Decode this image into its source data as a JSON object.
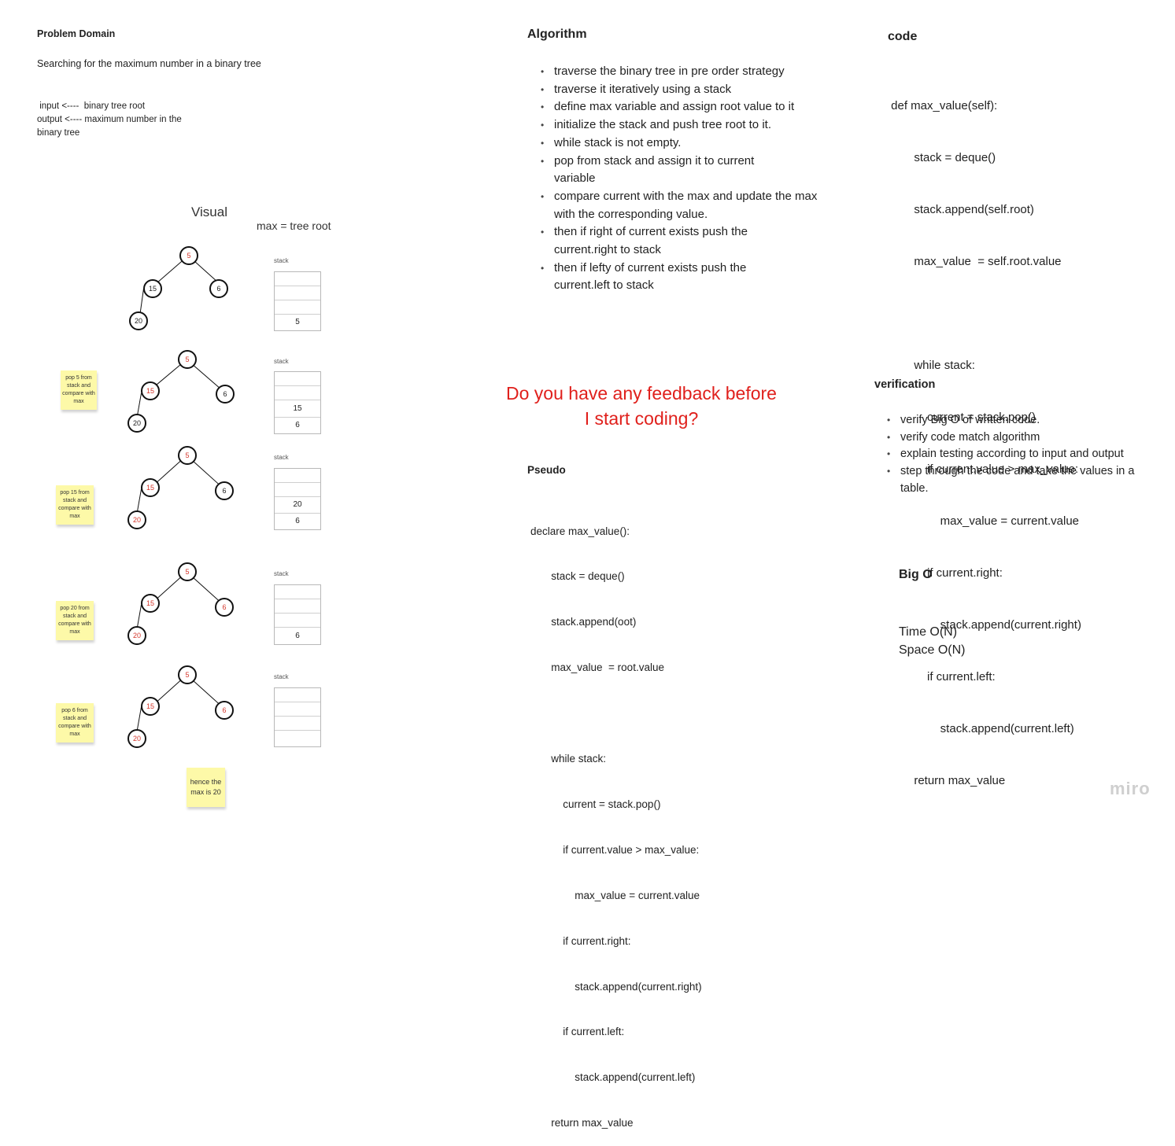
{
  "problem": {
    "title": "Problem Domain",
    "description": "Searching for the maximum number in a binary tree",
    "io_lines": [
      " input <----  binary tree root",
      "output <---- maximum number in the",
      "binary tree"
    ]
  },
  "visual": {
    "title": "Visual",
    "max_note": "max = tree root",
    "stack_label": "stack",
    "step1": {
      "nodes": [
        "5",
        "15",
        "6",
        "20"
      ],
      "stack": [
        "",
        "",
        "",
        "5"
      ]
    },
    "step2": {
      "nodes": [
        "5",
        "15",
        "6",
        "20"
      ],
      "stack": [
        "",
        "",
        "15",
        "6"
      ],
      "note": "pop 5 from stack and compare with max"
    },
    "step3": {
      "nodes": [
        "5",
        "15",
        "6",
        "20"
      ],
      "stack": [
        "",
        "",
        "20",
        "6"
      ],
      "note": "pop 15 from stack and compare with max"
    },
    "step4": {
      "nodes": [
        "5",
        "15",
        "6",
        "20"
      ],
      "stack": [
        "",
        "",
        "",
        "6"
      ],
      "note": "pop 20 from stack and compare with max"
    },
    "step5": {
      "nodes": [
        "5",
        "15",
        "6",
        "20"
      ],
      "stack": [
        "",
        "",
        "",
        ""
      ],
      "note": "pop 6 from stack and compare with max"
    },
    "conclusion": "hence the max is 20"
  },
  "algorithm": {
    "title": "Algorithm",
    "items": [
      "traverse the binary tree in pre order strategy",
      "traverse it iteratively using a stack",
      "define max variable and assign root value to it",
      "initialize the stack and push tree root to it.",
      "while stack is not empty.",
      "pop from stack and assign it to current variable",
      "compare current  with the max and update the max with the corresponding value.",
      "then if right of current exists push the current.right to stack",
      "then if lefty of current exists push the current.left to stack"
    ]
  },
  "feedback": {
    "line1": "Do you have any feedback before",
    "line2": "I start coding?",
    "color": "#e0201c"
  },
  "pseudo": {
    "title": "Pseudo",
    "lines": [
      "declare max_value():",
      "       stack = deque()",
      "       stack.append(oot)",
      "       max_value  = root.value",
      "",
      "       while stack:",
      "           current = stack.pop()",
      "           if current.value > max_value:",
      "               max_value = current.value",
      "           if current.right:",
      "               stack.append(current.right)",
      "           if current.left:",
      "               stack.append(current.left)",
      "       return max_value"
    ]
  },
  "code": {
    "title": "code",
    "lines": [
      " def max_value(self):",
      "        stack = deque()",
      "        stack.append(self.root)",
      "        max_value  = self.root.value",
      "",
      "        while stack:",
      "            current = stack.pop()",
      "            if current.value > max_value:",
      "                max_value = current.value",
      "            if current.right:",
      "                stack.append(current.right)",
      "            if current.left:",
      "                stack.append(current.left)",
      "        return max_value"
    ]
  },
  "verification": {
    "title": "verification",
    "items": [
      "verify Big O of written code.",
      "verify code match algorithm",
      "explain testing according to input and output",
      "step through the code and take the values in a table."
    ]
  },
  "bigo": {
    "title": "Big O",
    "time": "Time O(N)",
    "space": "Space O(N)"
  },
  "watermark": "miro"
}
